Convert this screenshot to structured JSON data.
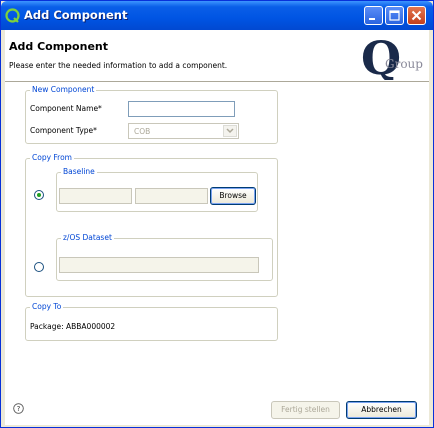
{
  "window": {
    "title": "Add Component"
  },
  "header": {
    "title": "Add Component",
    "description": "Please enter the needed information to add a component.",
    "logo_text": "Q",
    "logo_subtext": "Group"
  },
  "new_component": {
    "legend": "New Component",
    "name_label": "Component Name*",
    "name_value": "",
    "type_label": "Component Type*",
    "type_value": "COB"
  },
  "copy_from": {
    "legend": "Copy From",
    "baseline": {
      "legend": "Baseline",
      "selected": true,
      "field1": "",
      "field2": "",
      "browse_label": "Browse"
    },
    "dataset": {
      "legend": "z/OS Dataset",
      "selected": false,
      "value": ""
    }
  },
  "copy_to": {
    "legend": "Copy To",
    "package_text": "Package: ABBA000002"
  },
  "footer": {
    "finish_label": "Fertig stellen",
    "cancel_label": "Abbrechen"
  },
  "colors": {
    "titlebar": "#0054e3",
    "group_legend": "#0046d5",
    "dialog_bg": "#ece9d8"
  }
}
